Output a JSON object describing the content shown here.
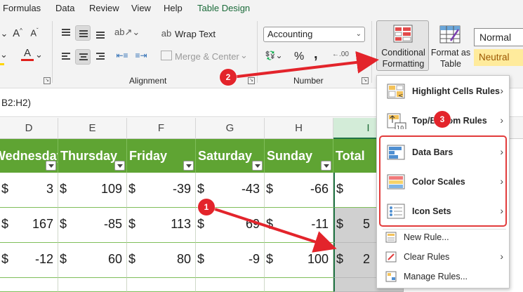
{
  "menu": {
    "tabs": [
      "Formulas",
      "Data",
      "Review",
      "View",
      "Help",
      "Table Design"
    ],
    "active_tab": "Table Design"
  },
  "ribbon": {
    "wrap_text": "Wrap Text",
    "merge_center": "Merge & Center",
    "alignment_label": "Alignment",
    "number_format": "Accounting",
    "number_label": "Number",
    "percent_symbol": "%",
    "comma_symbol": ",",
    "conditional_formatting_line1": "Conditional",
    "conditional_formatting_line2": "Formatting",
    "format_as_table_line1": "Format as",
    "format_as_table_line2": "Table",
    "style_normal": "Normal",
    "style_neutral": "Neutral"
  },
  "formula_bar": {
    "text": "B2:H2)"
  },
  "columns": [
    "D",
    "E",
    "F",
    "G",
    "H",
    "I"
  ],
  "table": {
    "headers": [
      "Wednesday",
      "Thursday",
      "Friday",
      "Saturday",
      "Sunday",
      "Total"
    ],
    "currency": "$",
    "rows": [
      [
        "3",
        "109",
        "-39",
        "-43",
        "-66",
        ""
      ],
      [
        "167",
        "-85",
        "113",
        "69",
        "-11",
        "5"
      ],
      [
        "-12",
        "60",
        "80",
        "-9",
        "100",
        "2"
      ],
      [
        "",
        "",
        "",
        "",
        "",
        ""
      ]
    ]
  },
  "dropdown": {
    "items": [
      {
        "label": "Highlight Cells Rules",
        "icon": "highlight-cells-icon"
      },
      {
        "label": "Top/Bottom Rules",
        "icon": "top-bottom-icon"
      },
      {
        "label": "Data Bars",
        "icon": "data-bars-icon"
      },
      {
        "label": "Color Scales",
        "icon": "color-scales-icon"
      },
      {
        "label": "Icon Sets",
        "icon": "icon-sets-icon"
      }
    ],
    "small_items": [
      {
        "label": "New Rule...",
        "has_submenu": false
      },
      {
        "label": "Clear Rules",
        "has_submenu": true
      },
      {
        "label": "Manage Rules...",
        "has_submenu": false
      }
    ]
  },
  "annotations": {
    "steps": [
      "1",
      "2",
      "3"
    ],
    "color": "#e3242b"
  },
  "colors": {
    "table_header": "#5fa433",
    "accent_green": "#217346",
    "annotation_red": "#e3242b",
    "neutral_style": "#ffeb9c"
  }
}
